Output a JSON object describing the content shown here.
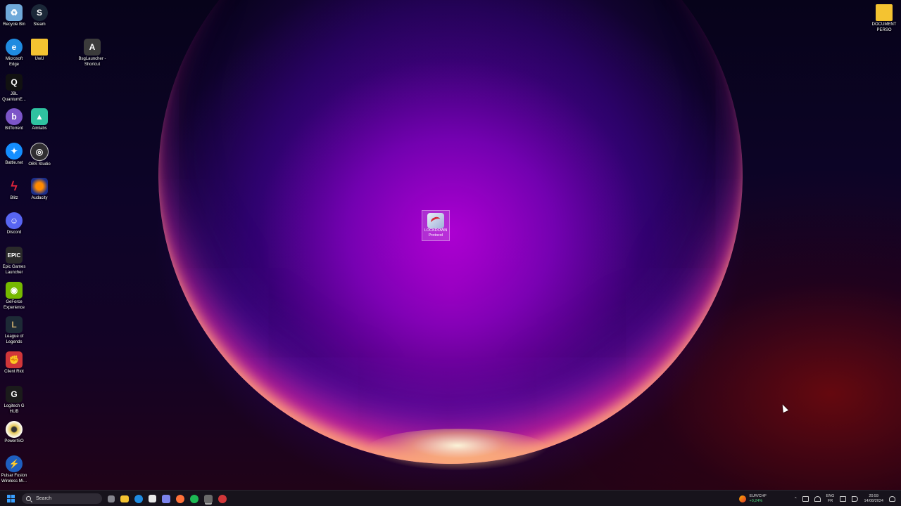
{
  "desktop": {
    "icons": [
      {
        "label": "Recycle Bin",
        "icon": "recycle-bin-icon",
        "color": "#6fa9d9"
      },
      {
        "label": "Steam",
        "icon": "steam-icon",
        "color": "#1b2838"
      },
      {
        "label": "Microsoft Edge",
        "icon": "edge-icon",
        "color": "#1f8be0"
      },
      {
        "label": "UwU",
        "icon": "folder-icon",
        "color": "#f4c331"
      },
      {
        "label": "BsgLauncher - Shortcut",
        "icon": "bsg-launcher-icon",
        "color": "#3b3b3b"
      },
      {
        "label": "JBL QuantumE...",
        "icon": "jbl-quantum-icon",
        "color": "#111111"
      },
      {
        "label": "BitTorrent",
        "icon": "bittorrent-icon",
        "color": "#7c55c8"
      },
      {
        "label": "Aimlabs",
        "icon": "aimlabs-icon",
        "color": "#2fc2a0"
      },
      {
        "label": "Battle.net",
        "icon": "battlenet-icon",
        "color": "#148eff"
      },
      {
        "label": "OBS Studio",
        "icon": "obs-icon",
        "color": "#302e31"
      },
      {
        "label": "Blitz",
        "icon": "blitz-icon",
        "color": "#e0243b"
      },
      {
        "label": "Audacity",
        "icon": "audacity-icon",
        "color": "#1a2e8c"
      },
      {
        "label": "Discord",
        "icon": "discord-icon",
        "color": "#5865f2"
      },
      {
        "label": "Epic Games Launcher",
        "icon": "epic-games-icon",
        "color": "#2a2a2a"
      },
      {
        "label": "GeForce Experience",
        "icon": "geforce-icon",
        "color": "#76b900"
      },
      {
        "label": "League of Legends",
        "icon": "league-icon",
        "color": "#c8aa6e"
      },
      {
        "label": "Client Riot",
        "icon": "riot-client-icon",
        "color": "#d13639"
      },
      {
        "label": "Logitech G HUB",
        "icon": "logitech-ghub-icon",
        "color": "#1b1b1b"
      },
      {
        "label": "PowerISO",
        "icon": "poweriso-icon",
        "color": "#e6c85a"
      },
      {
        "label": "Pulsar Fusion Wireless Mi...",
        "icon": "pulsar-icon",
        "color": "#1e5fbf"
      },
      {
        "label": "DOCUMENT PERSO",
        "icon": "folder-icon",
        "color": "#f4c331"
      }
    ],
    "center_icon": {
      "label": "LOCKDOWN Protocol",
      "icon": "lockdown-protocol-icon"
    }
  },
  "taskbar": {
    "search_placeholder": "Search",
    "apps": [
      {
        "name": "task-view-icon",
        "color": "#cfd2d8"
      },
      {
        "name": "file-explorer-icon",
        "color": "#f4c331"
      },
      {
        "name": "edge-icon",
        "color": "#1f8be0"
      },
      {
        "name": "store-icon",
        "color": "#e8e8e8"
      },
      {
        "name": "teams-icon",
        "color": "#7b83eb"
      },
      {
        "name": "firefox-icon",
        "color": "#ff7139"
      },
      {
        "name": "spotify-icon",
        "color": "#1db954"
      },
      {
        "name": "bsg-launcher-icon",
        "color": "#6a6a6a"
      },
      {
        "name": "riot-client-icon",
        "color": "#d13639"
      }
    ],
    "ticker": {
      "pair": "EUR/CHF",
      "change": "+0,24%"
    },
    "lang": {
      "line1": "ENG",
      "line2": "FR"
    },
    "clock": {
      "time": "20:59",
      "date": "14/08/2024"
    }
  }
}
